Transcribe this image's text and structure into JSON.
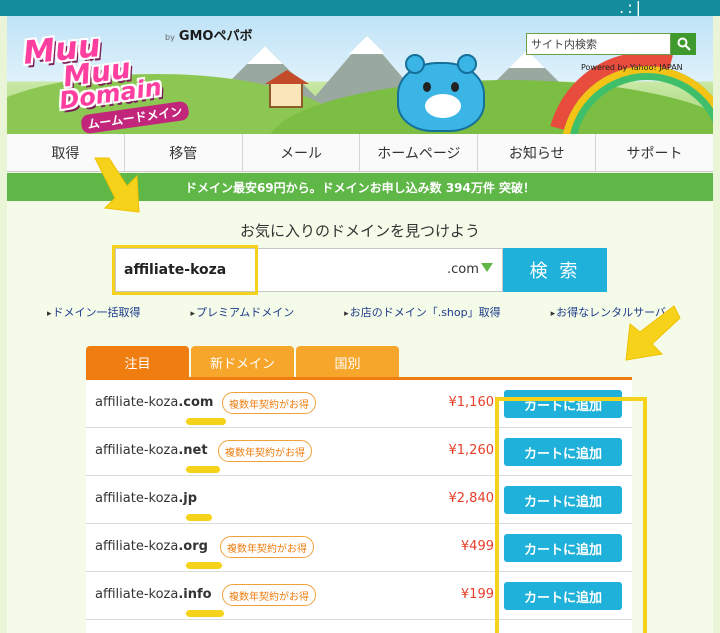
{
  "header": {
    "logo_text": [
      "Muu",
      "Muu",
      "Domain"
    ],
    "logo_kana": "ムームードメイン",
    "gmo_by": "by",
    "gmo_text": "GMOペパボ",
    "site_search_placeholder": "サイト内検索",
    "powered_text": "Powered by Yahoo! JAPAN"
  },
  "nav": {
    "items": [
      "取得",
      "移管",
      "メール",
      "ホームページ",
      "お知らせ",
      "サポート"
    ]
  },
  "banner": {
    "text": "ドメイン最安69円から。ドメインお申し込み数 394万件 突破！"
  },
  "search": {
    "title": "お気に入りのドメインを見つけよう",
    "value": "affiliate-koza",
    "tld": ".com",
    "button_label": "検 索"
  },
  "links": [
    "ドメイン一括取得",
    "プレミアムドメイン",
    "お店のドメイン「.shop」取得",
    "お得なレンタルサーバー"
  ],
  "tabs": [
    "注目",
    "新ドメイン",
    "国別"
  ],
  "results": [
    {
      "name": "affiliate-koza",
      "tld": ".com",
      "badge": "複数年契約がお得",
      "price": "¥1,160",
      "cart": "カートに追加"
    },
    {
      "name": "affiliate-koza",
      "tld": ".net",
      "badge": "複数年契約がお得",
      "price": "¥1,260",
      "cart": "カートに追加"
    },
    {
      "name": "affiliate-koza",
      "tld": ".jp",
      "badge": "",
      "price": "¥2,840",
      "cart": "カートに追加"
    },
    {
      "name": "affiliate-koza",
      "tld": ".org",
      "badge": "複数年契約がお得",
      "price": "¥499",
      "cart": "カートに追加"
    },
    {
      "name": "affiliate-koza",
      "tld": ".info",
      "badge": "複数年契約がお得",
      "price": "¥199",
      "cart": "カートに追加"
    }
  ],
  "colors": {
    "accent_blue": "#1fb1da",
    "tab_orange": "#ef7d0f",
    "banner_green": "#5fb748",
    "highlight_yellow": "#f6d21a",
    "price_red": "#e8402b"
  }
}
